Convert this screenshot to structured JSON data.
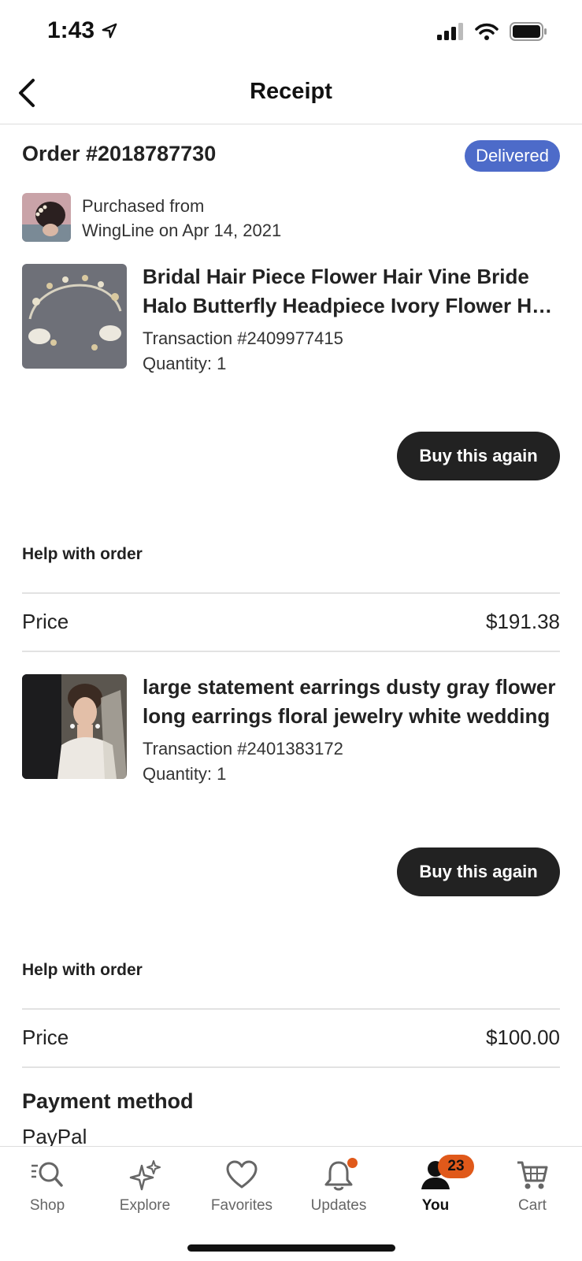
{
  "status": {
    "time": "1:43"
  },
  "header": {
    "title": "Receipt"
  },
  "order": {
    "number": "Order #2018787730",
    "status": "Delivered",
    "purchased_line1": "Purchased from",
    "purchased_line2": "WingLine on Apr 14, 2021"
  },
  "items": [
    {
      "title": "Bridal Hair Piece Flower Hair Vine Bride Halo Butterfly Headpiece Ivory Flower Hair Piece",
      "transaction": "Transaction #2409977415",
      "quantity": "Quantity: 1",
      "buy_label": "Buy this again",
      "help_label": "Help with order",
      "price_label": "Price",
      "price": "$191.38"
    },
    {
      "title": "large statement earrings dusty gray flower long earrings floral jewelry white wedding",
      "transaction": "Transaction #2401383172",
      "quantity": "Quantity: 1",
      "buy_label": "Buy this again",
      "help_label": "Help with order",
      "price_label": "Price",
      "price": "$100.00"
    }
  ],
  "payment": {
    "title": "Payment method",
    "value": "PayPal"
  },
  "tabs": [
    {
      "label": "Shop",
      "icon": "search-icon"
    },
    {
      "label": "Explore",
      "icon": "sparkle-icon"
    },
    {
      "label": "Favorites",
      "icon": "heart-icon"
    },
    {
      "label": "Updates",
      "icon": "bell-icon"
    },
    {
      "label": "You",
      "icon": "person-icon",
      "badge": "23"
    },
    {
      "label": "Cart",
      "icon": "cart-icon"
    }
  ],
  "colors": {
    "badge": "#4d6bc9",
    "accent": "#e0591a",
    "button": "#222222"
  }
}
